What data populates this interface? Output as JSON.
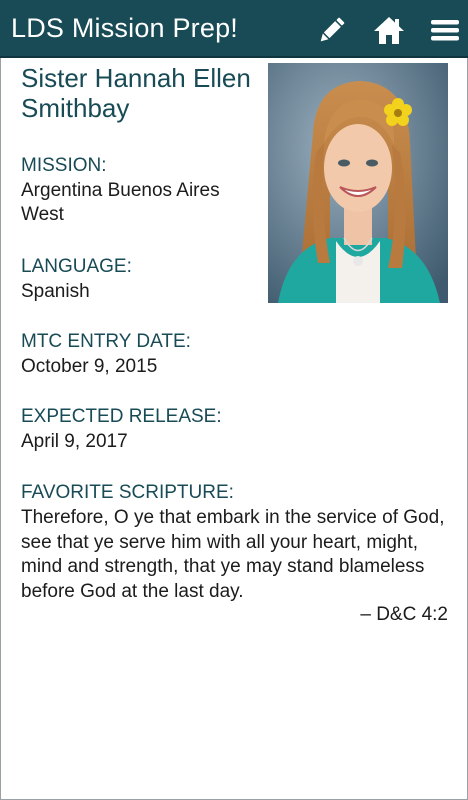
{
  "app": {
    "title": "LDS Mission Prep!"
  },
  "toolbar": {
    "edit_icon": "pencil-icon",
    "home_icon": "home-icon",
    "menu_icon": "hamburger-menu-icon"
  },
  "colors": {
    "appbar": "#184b55",
    "label_text": "#184b55",
    "body_text": "#1c1c1c"
  },
  "profile": {
    "name": "Sister Hannah Ellen Smithbay",
    "mission_label": "MISSION:",
    "mission_value": "Argentina Buenos Aires West",
    "language_label": "LANGUAGE:",
    "language_value": "Spanish",
    "mtc_label": "MTC ENTRY DATE:",
    "mtc_value": "October 9, 2015",
    "release_label": "EXPECTED RELEASE:",
    "release_value": "April 9, 2017",
    "scripture_label": "FAVORITE SCRIPTURE:",
    "scripture_text": "Therefore, O ye that embark in the service of God, see that ye serve him with all your heart, might, mind and strength, that ye may stand blameless before God at the last day.",
    "scripture_reference": "– D&C 4:2"
  }
}
